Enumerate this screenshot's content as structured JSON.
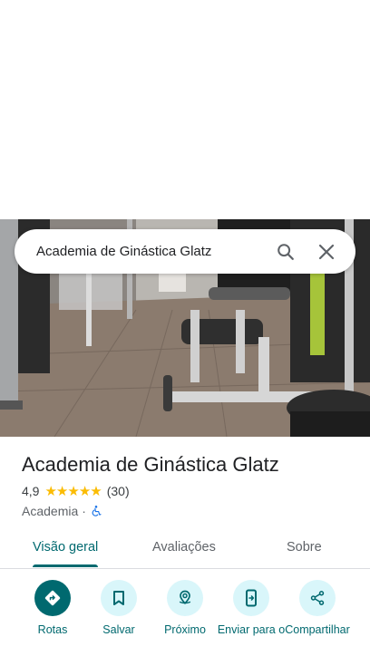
{
  "search": {
    "query": "Academia de Ginástica Glatz"
  },
  "place": {
    "title": "Academia de Ginástica Glatz",
    "rating": "4,9",
    "stars": 5,
    "review_count": "(30)",
    "category": "Academia",
    "separator": "·"
  },
  "tabs": [
    {
      "label": "Visão geral",
      "active": true
    },
    {
      "label": "Avaliações",
      "active": false
    },
    {
      "label": "Sobre",
      "active": false
    }
  ],
  "actions": [
    {
      "label": "Rotas",
      "icon": "directions-icon"
    },
    {
      "label": "Salvar",
      "icon": "bookmark-icon"
    },
    {
      "label": "Próximo",
      "icon": "nearby-icon"
    },
    {
      "label": "Enviar para o",
      "icon": "send-to-phone-icon"
    },
    {
      "label": "Compartilhar",
      "icon": "share-icon"
    }
  ],
  "colors": {
    "accent": "#00696f",
    "accent_light": "#d9f6fa",
    "star": "#fbbc04"
  }
}
